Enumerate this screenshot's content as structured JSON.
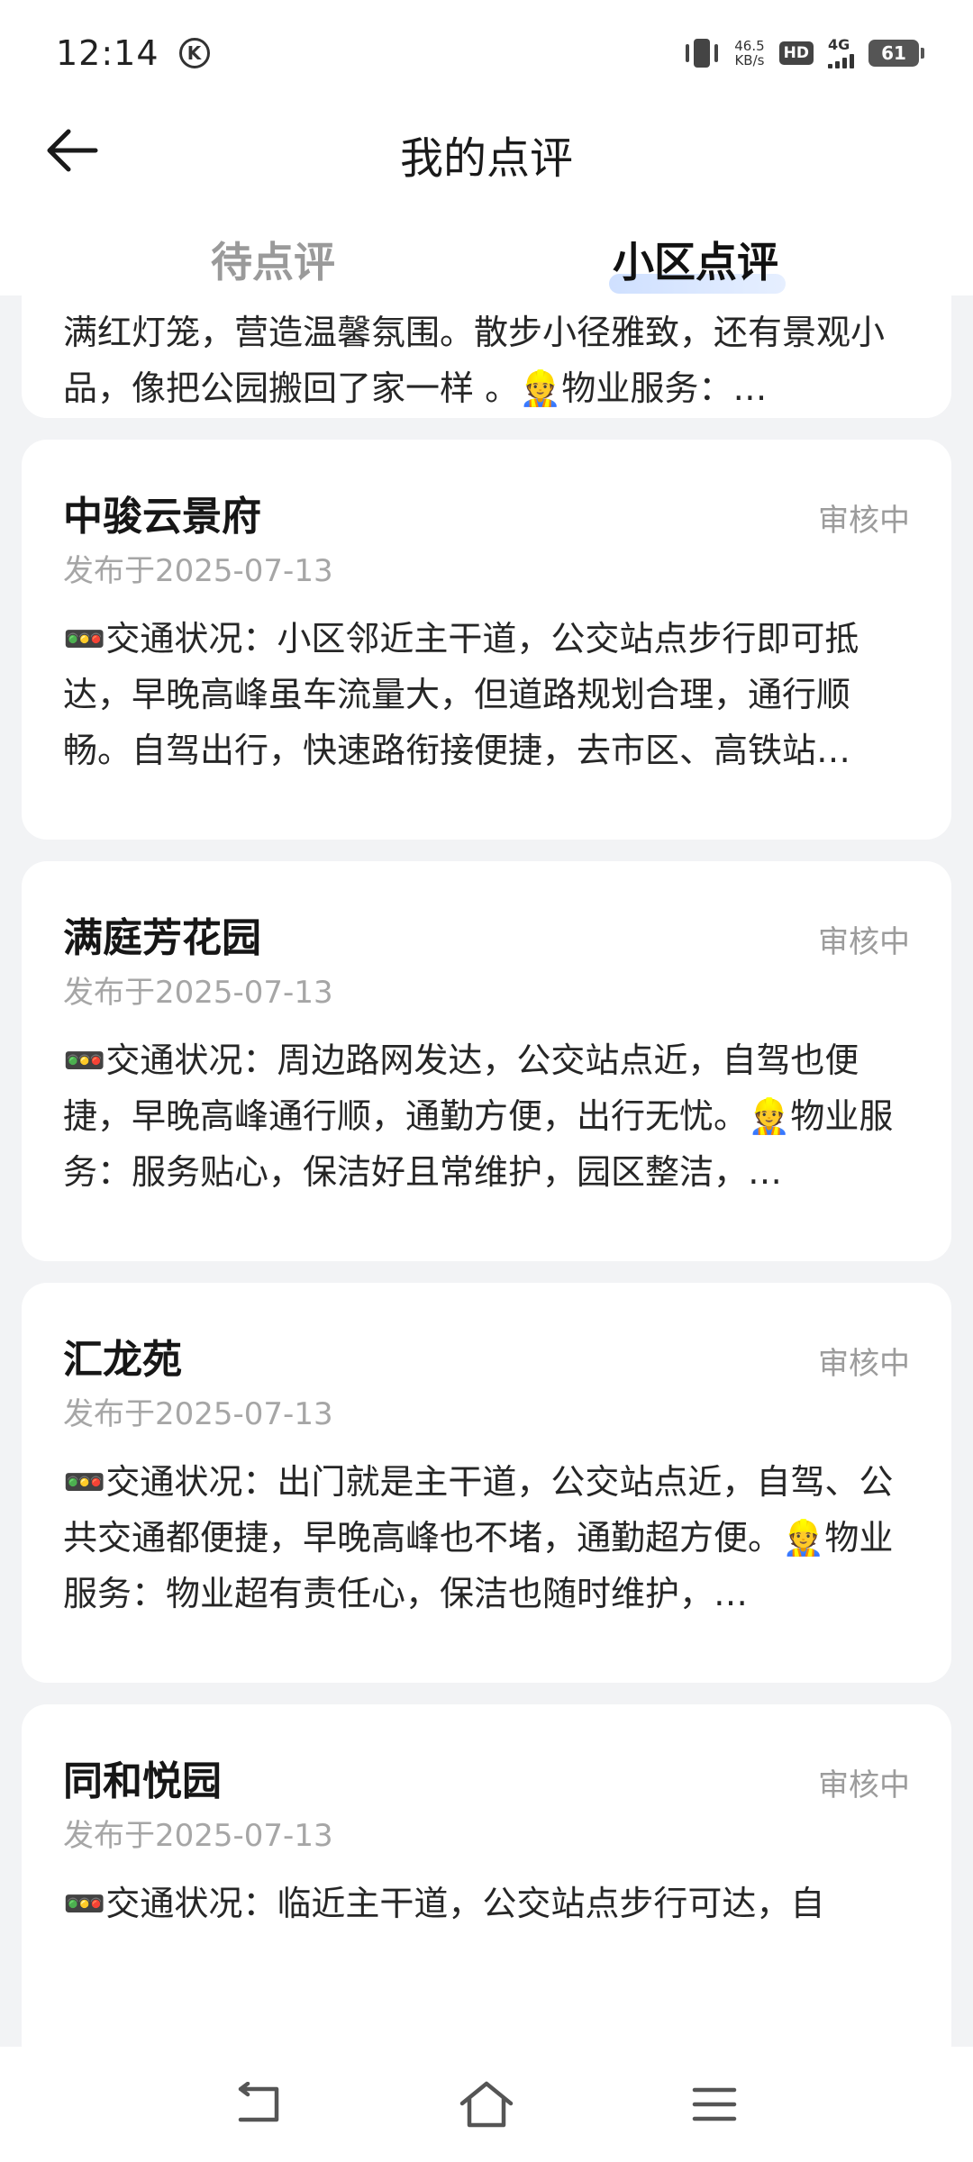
{
  "status_bar": {
    "time": "12:14",
    "k_badge": "K",
    "net_speed_value": "46.5",
    "net_speed_unit": "KB/s",
    "hd": "HD",
    "network": "4G",
    "battery": "61"
  },
  "header": {
    "title": "我的点评",
    "tabs": [
      {
        "label": "待点评",
        "active": false
      },
      {
        "label": "小区点评",
        "active": true
      }
    ]
  },
  "reviews": [
    {
      "name": "",
      "status": "",
      "date": "",
      "text": "👏小区特色：中式园林景观超好看，花草繁茂，树木挂满红灯笼，营造温馨氛围。散步小径雅致，还有景观小品，像把公园搬回了家一样 。👷物业服务：…"
    },
    {
      "name": "中骏云景府",
      "status": "审核中",
      "date": "发布于2025-07-13",
      "text": "🚥交通状况：小区邻近主干道，公交站点步行即可抵达，早晚高峰虽车流量大，但道路规划合理，通行顺畅。自驾出行，快速路衔接便捷，去市区、高铁站…"
    },
    {
      "name": "满庭芳花园",
      "status": "审核中",
      "date": "发布于2025-07-13",
      "text": "🚥交通状况：周边路网发达，公交站点近，自驾也便捷，早晚高峰通行顺，通勤方便，出行无忧。👷物业服务：服务贴心，保洁好且常维护，园区整洁，…"
    },
    {
      "name": "汇龙苑",
      "status": "审核中",
      "date": "发布于2025-07-13",
      "text": "🚥交通状况：出门就是主干道，公交站点近，自驾、公共交通都便捷，早晚高峰也不堵，通勤超方便。👷物业服务：物业超有责任心，保洁也随时维护，…"
    },
    {
      "name": "同和悦园",
      "status": "审核中",
      "date": "发布于2025-07-13",
      "text": "🚥交通状况：临近主干道，公交站点步行可达，自"
    }
  ],
  "colors": {
    "background": "#f2f3f5",
    "card": "#ffffff",
    "tab_active_underline": "#cfe0ff",
    "muted_text": "#9c9c9c"
  }
}
